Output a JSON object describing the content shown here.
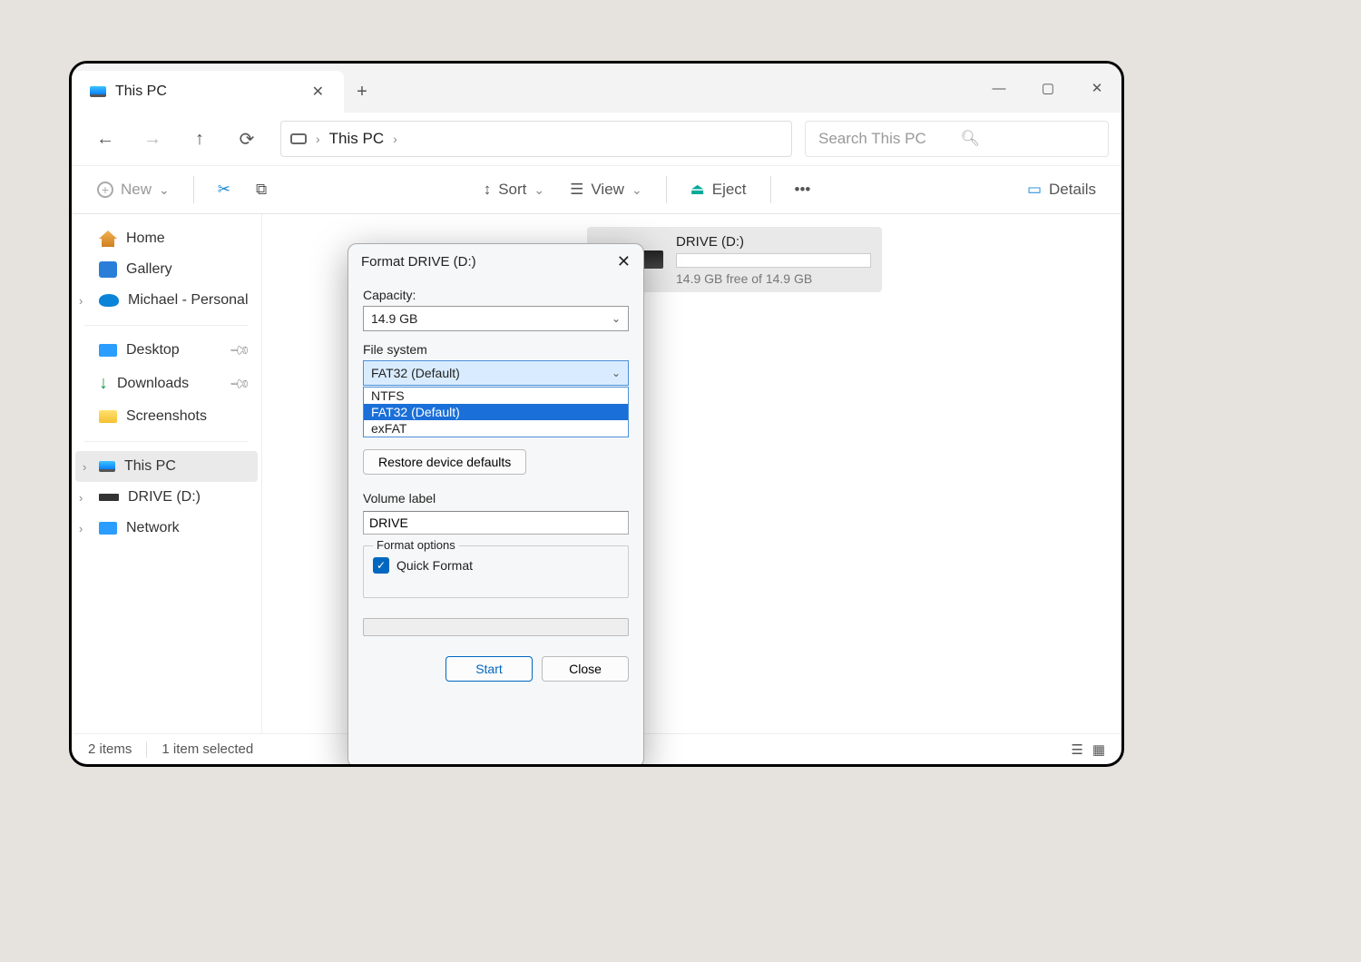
{
  "tab": {
    "title": "This PC"
  },
  "addressbar": {
    "current": "This PC"
  },
  "search": {
    "placeholder": "Search This PC"
  },
  "toolbar": {
    "new": "New",
    "sort": "Sort",
    "view": "View",
    "eject": "Eject",
    "details": "Details"
  },
  "sidebar": {
    "home": "Home",
    "gallery": "Gallery",
    "onedrive": "Michael - Personal",
    "desktop": "Desktop",
    "downloads": "Downloads",
    "screenshots": "Screenshots",
    "thispc": "This PC",
    "drive": "DRIVE (D:)",
    "network": "Network"
  },
  "drive_card": {
    "name": "DRIVE (D:)",
    "free": "14.9 GB free of 14.9 GB"
  },
  "statusbar": {
    "items": "2 items",
    "selected": "1 item selected"
  },
  "dialog": {
    "title": "Format DRIVE (D:)",
    "capacity_label": "Capacity:",
    "capacity_value": "14.9 GB",
    "fs_label": "File system",
    "fs_value": "FAT32 (Default)",
    "fs_options": {
      "ntfs": "NTFS",
      "fat32": "FAT32 (Default)",
      "exfat": "exFAT"
    },
    "restore": "Restore device defaults",
    "vol_label": "Volume label",
    "vol_value": "DRIVE",
    "fmt_options": "Format options",
    "quick_format": "Quick Format",
    "start": "Start",
    "close": "Close"
  }
}
